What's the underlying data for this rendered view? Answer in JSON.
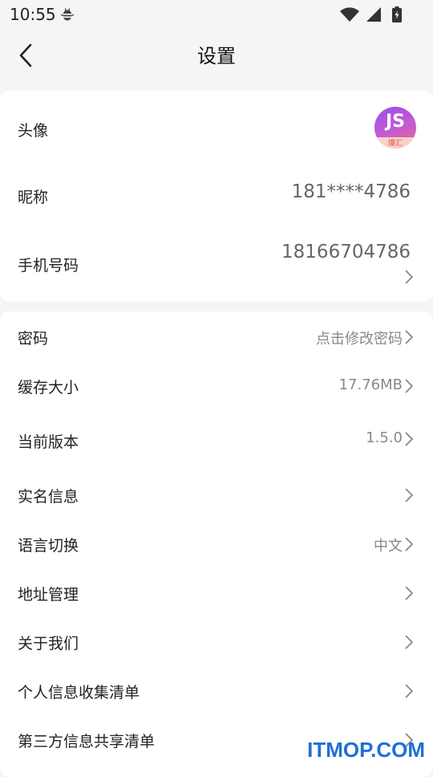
{
  "status_bar": {
    "time": "10:55"
  },
  "header": {
    "title": "设置"
  },
  "profile": {
    "avatar_label": "头像",
    "avatar_text": "爆汇",
    "nickname_label": "昵称",
    "nickname_value": "181****4786",
    "phone_label": "手机号码",
    "phone_value": "18166704786"
  },
  "settings": [
    {
      "label": "密码",
      "value": "点击修改密码"
    },
    {
      "label": "缓存大小",
      "value": "17.76MB"
    },
    {
      "label": "当前版本",
      "value": "1.5.0"
    },
    {
      "label": "实名信息",
      "value": ""
    },
    {
      "label": "语言切换",
      "value": "中文"
    },
    {
      "label": "地址管理",
      "value": ""
    },
    {
      "label": "关于我们",
      "value": ""
    },
    {
      "label": "个人信息收集清单",
      "value": ""
    },
    {
      "label": "第三方信息共享清单",
      "value": ""
    }
  ],
  "watermark": "ITMOP.COM"
}
